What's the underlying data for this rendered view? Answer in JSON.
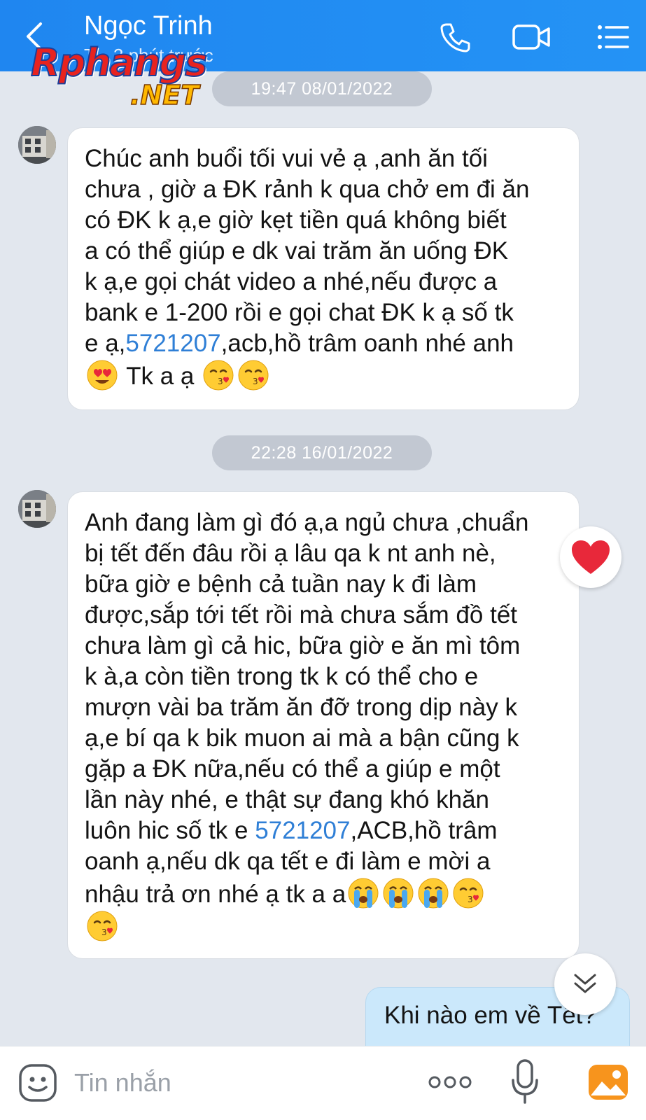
{
  "header": {
    "contact_name": "Ngọc Trinh",
    "status": "T... 2 phút trước",
    "bg_color": "#2190f3"
  },
  "watermark": {
    "line1": "Rphangs",
    "line2": ".NET"
  },
  "messages": [
    {
      "timestamp": "19:47 08/01/2022",
      "lines": [
        "Chúc anh buổi tối vui vẻ ạ ,anh ăn tối",
        "chưa , giờ a ĐK rảnh k qua chở em đi ăn",
        "có ĐK k ạ,e giờ kẹt tiền quá không biết",
        "a có thể giúp e dk vai trăm ăn uống ĐK",
        "k ạ,e gọi chát video a nhé,nếu được a",
        "bank e 1-200 rồi e gọi chat ĐK k ạ số tk"
      ],
      "line7_prefix": "e ạ,",
      "line7_link": "5721207",
      "line7_suffix": ",acb,hồ trâm oanh nhé anh",
      "line8_text": " Tk a ạ "
    },
    {
      "timestamp": "22:28 16/01/2022",
      "lines": [
        "Anh đang làm gì đó ạ,a ngủ chưa ,chuẩn",
        "bị tết đến đâu rồi ạ lâu qa k nt anh nè,",
        "bữa giờ e bệnh cả tuần nay k đi làm",
        "được,sắp tới tết rồi mà chưa sắm đồ tết",
        "chưa làm gì cả hic, bữa giờ e ăn mì tôm",
        "k à,a còn tiền trong tk k có thể cho e",
        "mượn vài ba trăm ăn đỡ trong dịp này k",
        "ạ,e bí qa k bik muon ai mà a bận cũng k",
        "gặp a ĐK nữa,nếu có thể a giúp e một",
        "lần này nhé, e thật sự đang khó khăn"
      ],
      "line11_prefix": "luôn hic số tk e ",
      "line11_link": "5721207",
      "line11_suffix": ",ACB,hồ trâm",
      "line12": "oanh ạ,nếu dk qa tết e đi làm e mời a",
      "line13_text": "nhậu trả ơn nhé ạ tk a a",
      "reaction": "heart"
    }
  ],
  "outgoing": {
    "text": "Khi nào em về Tết?"
  },
  "input_bar": {
    "placeholder": "Tin nhắn"
  },
  "icons": {
    "back": "back-arrow-icon",
    "call": "phone-icon",
    "video": "video-camera-icon",
    "menu": "list-menu-icon",
    "sticker": "sticker-face-icon",
    "more": "more-dots-icon",
    "mic": "microphone-icon",
    "gallery": "gallery-image-icon",
    "scroll": "double-chevron-down-icon"
  }
}
